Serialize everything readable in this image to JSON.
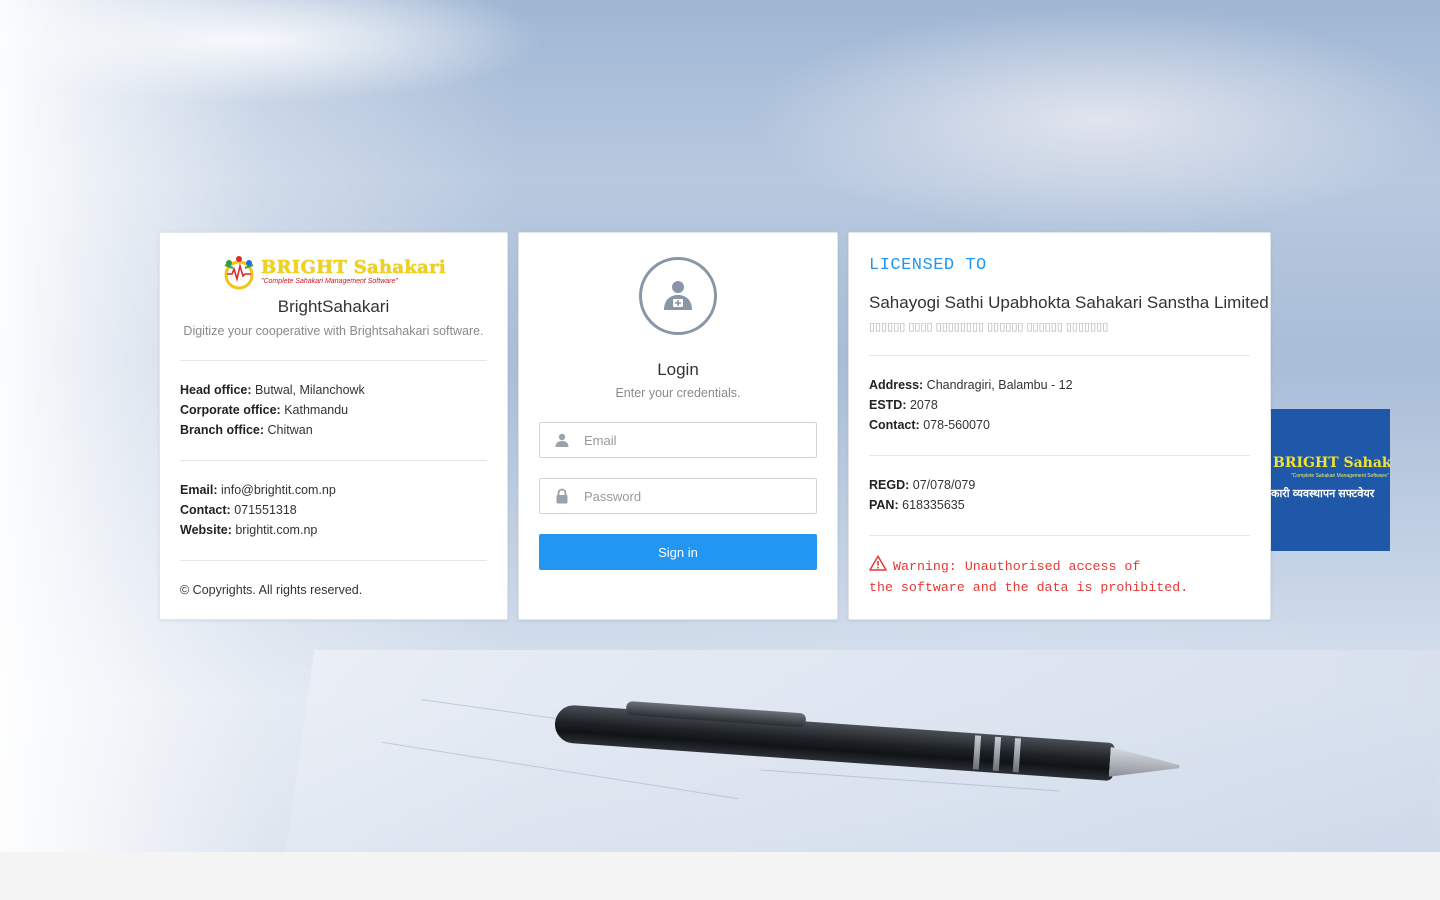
{
  "brand": {
    "logo_word": "BRIGHT Sahakari",
    "logo_tagline": "\"Complete Sahakari Management Software\"",
    "app_name": "BrightSahakari",
    "app_desc": "Digitize your cooperative with Brightsahakari software."
  },
  "offices": [
    {
      "label": "Head office:",
      "value": "Butwal, Milanchowk"
    },
    {
      "label": "Corporate office:",
      "value": "Kathmandu"
    },
    {
      "label": "Branch office:",
      "value": "Chitwan"
    }
  ],
  "contact": [
    {
      "label": "Email:",
      "value": "info@brightit.com.np"
    },
    {
      "label": "Contact:",
      "value": "071551318"
    },
    {
      "label": "Website:",
      "value": "brightit.com.np"
    }
  ],
  "copyright": "© Copyrights. All rights reserved.",
  "login": {
    "title": "Login",
    "subtitle": "Enter your credentials.",
    "email_placeholder": "Email",
    "password_placeholder": "Password",
    "submit_label": "Sign in",
    "icons": {
      "avatar": "user-settings-icon",
      "email": "user-icon",
      "password": "lock-icon"
    }
  },
  "license": {
    "heading": "LICENSED TO",
    "org_name": "Sahayogi Sathi Upabhokta Sahakari Sanstha Limited",
    "org_name_native": "▯▯▯▯▯▯ ▯▯▯▯ ▯▯▯▯▯▯▯▯ ▯▯▯▯▯▯ ▯▯▯▯▯▯ ▯▯▯▯▯▯▯",
    "details": [
      {
        "label": "Address:",
        "value": "Chandragiri, Balambu - 12"
      },
      {
        "label": "ESTD:",
        "value": "2078"
      },
      {
        "label": "Contact:",
        "value": "078-560070"
      }
    ],
    "registration": [
      {
        "label": "REGD:",
        "value": "07/078/079"
      },
      {
        "label": "PAN:",
        "value": "618335635"
      }
    ],
    "warning_line1": "Warning: Unauthorised access of",
    "warning_line2": "the software and the data is prohibited."
  },
  "side_logo": {
    "word": "BRIGHT Sahakari",
    "tagline": "\"Complete Sahakari Management Software\"",
    "native": "कारी व्यवस्थापन सफ्टवेयर"
  },
  "colors": {
    "accent": "#2196f3",
    "warning": "#e53935",
    "side_logo_bg": "#1f58a8"
  }
}
